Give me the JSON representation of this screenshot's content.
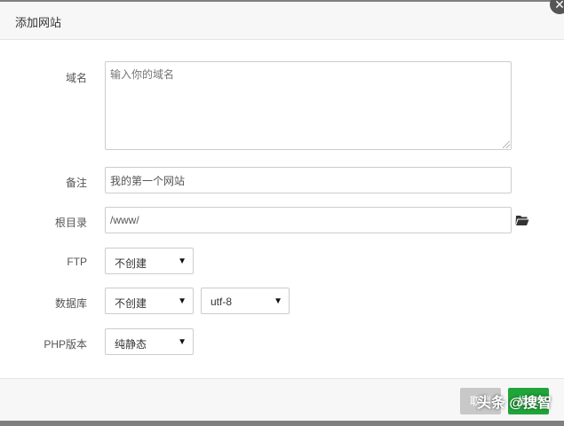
{
  "dialog": {
    "title": "添加网站"
  },
  "form": {
    "domain": {
      "label": "域名",
      "placeholder": "输入你的域名"
    },
    "remark": {
      "label": "备注",
      "value": "我的第一个网站"
    },
    "root_dir": {
      "label": "根目录",
      "value": "/www/"
    },
    "ftp": {
      "label": "FTP",
      "selected": "不创建"
    },
    "database": {
      "label": "数据库",
      "selected": "不创建",
      "charset": "utf-8"
    },
    "php": {
      "label": "PHP版本",
      "selected": "纯静态"
    }
  },
  "footer": {
    "cancel_label": "取消",
    "submit_label": "提交"
  },
  "watermark": "头条 @搜智",
  "colors": {
    "submit": "#20a53a",
    "cancel": "#c8c8c8"
  },
  "icons": {
    "close": "close-icon",
    "folder": "folder-open-icon",
    "caret": "caret-down-icon"
  }
}
